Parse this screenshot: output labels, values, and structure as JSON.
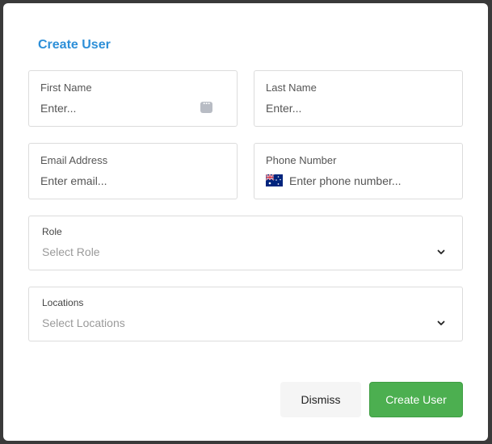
{
  "dialog": {
    "title": "Create User"
  },
  "form": {
    "first_name": {
      "label": "First Name",
      "placeholder": "Enter..."
    },
    "last_name": {
      "label": "Last Name",
      "placeholder": "Enter..."
    },
    "email": {
      "label": "Email Address",
      "placeholder": "Enter email..."
    },
    "phone": {
      "label": "Phone Number",
      "placeholder": "Enter phone number...",
      "country_flag": "australia-flag-icon"
    },
    "role": {
      "label": "Role",
      "placeholder": "Select Role"
    },
    "locations": {
      "label": "Locations",
      "placeholder": "Select Locations"
    }
  },
  "actions": {
    "dismiss_label": "Dismiss",
    "create_label": "Create User"
  },
  "colors": {
    "title": "#2d8fd8",
    "primary_button": "#4caf50",
    "secondary_button": "#f5f5f5"
  }
}
